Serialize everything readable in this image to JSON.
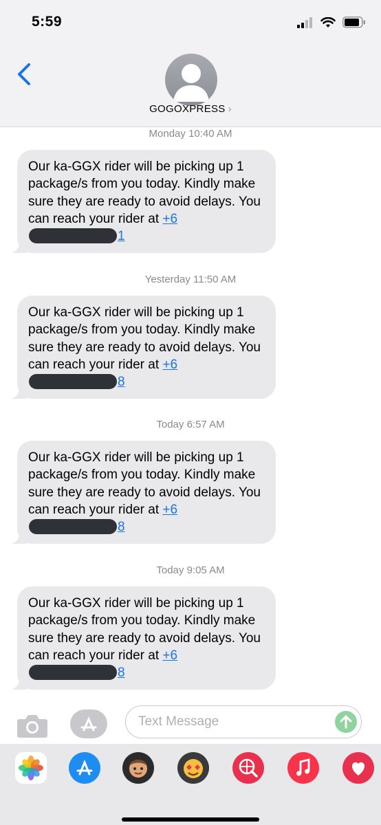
{
  "status": {
    "time": "5:59"
  },
  "header": {
    "contact_name": "GOGOXPRESS",
    "chevron": "›"
  },
  "messages": [
    {
      "timestamp": "Monday 10:40 AM",
      "text": "Our ka-GGX rider will be picking up 1 package/s from you today. Kindly make sure they are ready to avoid delays. You can reach your rider at",
      "phone_start": "+6",
      "phone_end": "1"
    },
    {
      "timestamp": "Yesterday 11:50 AM",
      "text": "Our ka-GGX rider will be picking up 1 package/s from you today. Kindly make sure they are ready to avoid delays. You can reach your rider at",
      "phone_start": "+6",
      "phone_end": "8"
    },
    {
      "timestamp": "Today 6:57 AM",
      "text": "Our ka-GGX rider will be picking up 1 package/s from you today. Kindly make sure they are ready to avoid delays. You can reach your rider at",
      "phone_start": "+6",
      "phone_end": "8"
    },
    {
      "timestamp": "Today 9:05 AM",
      "text": "Our ka-GGX rider will be picking up 1 package/s from you today. Kindly make sure they are ready to avoid delays. You can reach your rider at",
      "phone_start": "+6",
      "phone_end": "8"
    }
  ],
  "composer": {
    "placeholder": "Text Message"
  },
  "colors": {
    "accent": "#1a73e8",
    "bubble": "#e9e9eb",
    "send_disabled": "#8fd49e"
  },
  "dock_apps": [
    "photos-icon",
    "app-store-icon",
    "memoji-icon",
    "animoji-icon",
    "search-globe-icon",
    "music-icon",
    "heart-app-icon"
  ]
}
